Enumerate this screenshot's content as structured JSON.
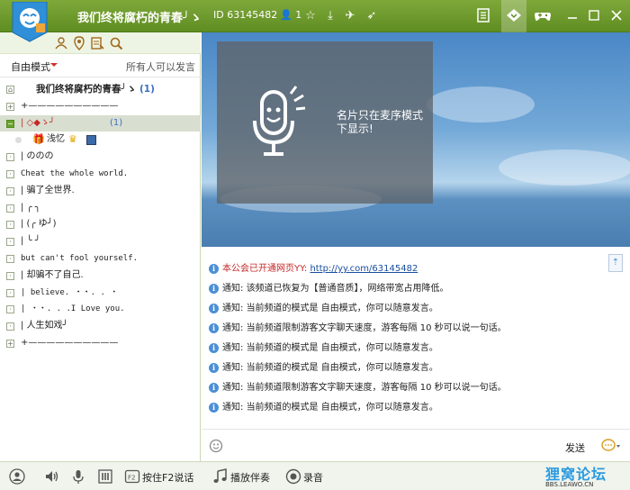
{
  "titlebar": {
    "title": "我们终将腐朽的青春╯ゝ",
    "id_label": "ID 63145482",
    "user_count": "1"
  },
  "left": {
    "mode_label": "自由模式",
    "permission": "所有人可以发言",
    "tree": [
      {
        "type": "channel",
        "text": "我们终将腐朽的青春╯ゝ",
        "count": "(1)"
      },
      {
        "type": "plain",
        "text": "+——————————"
      },
      {
        "type": "selected",
        "text": "| ◇◆ゝ╯",
        "count": "(1)"
      },
      {
        "type": "user",
        "text": "浅忆"
      },
      {
        "type": "plain",
        "text": "|           ののの"
      },
      {
        "type": "plain",
        "text": "Cheat the whole world."
      },
      {
        "type": "plain",
        "text": "|      骗了全世界."
      },
      {
        "type": "plain",
        "text": "|             ╭ ╮"
      },
      {
        "type": "plain",
        "text": "|           (╭ ゆ╯)"
      },
      {
        "type": "plain",
        "text": "|             ╰ ╯"
      },
      {
        "type": "plain",
        "text": "but can't fool yourself."
      },
      {
        "type": "plain",
        "text": "|      却骗不了自己."
      },
      {
        "type": "plain",
        "text": "| believe. ・・. .  ・"
      },
      {
        "type": "plain",
        "text": "| ・・. . .I Love you."
      },
      {
        "type": "plain",
        "text": "|      人生如戏╯"
      },
      {
        "type": "plain",
        "text": "+——————————"
      }
    ]
  },
  "banner": {
    "card_text_line1": "名片只在麦序模式",
    "card_text_line2": "下显示!"
  },
  "chat": {
    "messages": [
      {
        "prefix": "本公会已开通网页YY:",
        "link": "http://yy.com/63145482",
        "text": ""
      },
      {
        "prefix": "通知:",
        "text": "该频道已恢复为【普通音质】，网络带宽占用降低。"
      },
      {
        "prefix": "通知:",
        "text": "当前频道的模式是 自由模式，你可以随意发言。"
      },
      {
        "prefix": "通知:",
        "text": "当前频道限制游客文字聊天速度，游客每隔 10 秒可以说一句话。"
      },
      {
        "prefix": "通知:",
        "text": "当前频道的模式是 自由模式，你可以随意发言。"
      },
      {
        "prefix": "通知:",
        "text": "当前频道的模式是 自由模式，你可以随意发言。"
      },
      {
        "prefix": "通知:",
        "text": "当前频道限制游客文字聊天速度，游客每隔 10 秒可以说一句话。"
      },
      {
        "prefix": "通知:",
        "text": "当前频道的模式是 自由模式，你可以随意发言。"
      }
    ],
    "send_label": "发送"
  },
  "bottom": {
    "ptt_label": "按住F2说话",
    "music_label": "播放伴奏",
    "record_label": "录音",
    "watermark_top": "狸窝论坛",
    "watermark_bottom": "BBS.LEAWO.CN"
  },
  "colors": {
    "titlebar": "#6a9a2a",
    "selected_row": "#d8dfd0",
    "notice_red": "#c62828",
    "link_blue": "#1a4ea0"
  }
}
